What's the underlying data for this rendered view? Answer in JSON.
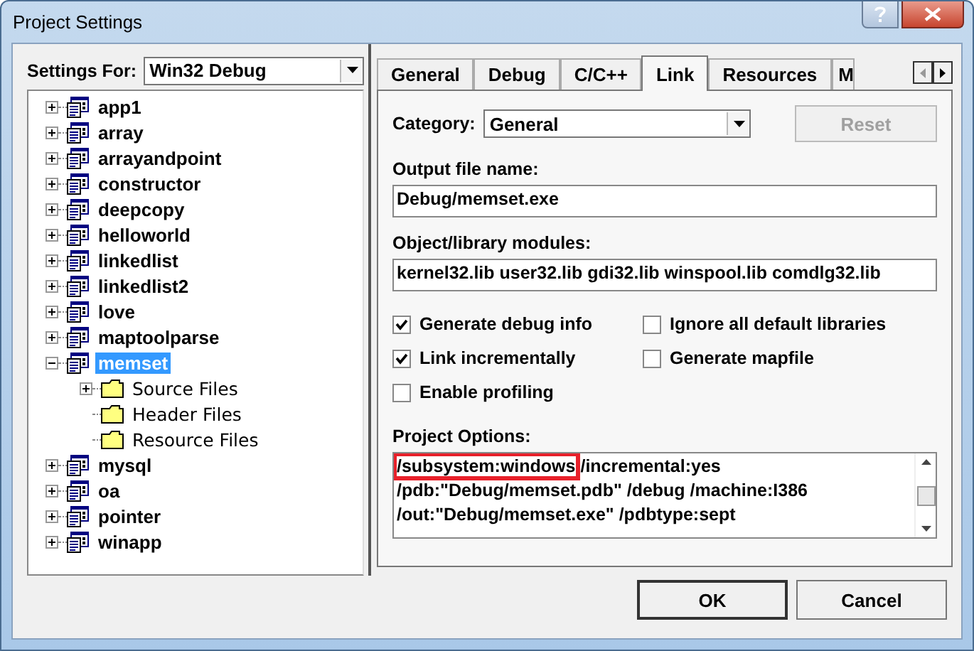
{
  "window": {
    "title": "Project Settings"
  },
  "settings_for": {
    "label": "Settings For:",
    "value": "Win32 Debug"
  },
  "tree": [
    {
      "label": "app1",
      "kind": "project",
      "expanded": false,
      "selected": false
    },
    {
      "label": "array",
      "kind": "project",
      "expanded": false,
      "selected": false
    },
    {
      "label": "arrayandpoint",
      "kind": "project",
      "expanded": false,
      "selected": false
    },
    {
      "label": "constructor",
      "kind": "project",
      "expanded": false,
      "selected": false
    },
    {
      "label": "deepcopy",
      "kind": "project",
      "expanded": false,
      "selected": false
    },
    {
      "label": "helloworld",
      "kind": "project",
      "expanded": false,
      "selected": false
    },
    {
      "label": "linkedlist",
      "kind": "project",
      "expanded": false,
      "selected": false
    },
    {
      "label": "linkedlist2",
      "kind": "project",
      "expanded": false,
      "selected": false
    },
    {
      "label": "love",
      "kind": "project",
      "expanded": false,
      "selected": false
    },
    {
      "label": "maptoolparse",
      "kind": "project",
      "expanded": false,
      "selected": false
    },
    {
      "label": "memset",
      "kind": "project",
      "expanded": true,
      "selected": true,
      "children": [
        {
          "label": "Source Files",
          "kind": "folder",
          "expanded": false,
          "selected": false
        },
        {
          "label": "Header Files",
          "kind": "folder",
          "selected": false
        },
        {
          "label": "Resource Files",
          "kind": "folder",
          "selected": false
        }
      ]
    },
    {
      "label": "mysql",
      "kind": "project",
      "expanded": false,
      "selected": false
    },
    {
      "label": "oa",
      "kind": "project",
      "expanded": false,
      "selected": false
    },
    {
      "label": "pointer",
      "kind": "project",
      "expanded": false,
      "selected": false
    },
    {
      "label": "winapp",
      "kind": "project",
      "expanded": false,
      "selected": false
    }
  ],
  "tabs": [
    {
      "label": "General",
      "selected": false
    },
    {
      "label": "Debug",
      "selected": false
    },
    {
      "label": "C/C++",
      "selected": false
    },
    {
      "label": "Link",
      "selected": true
    },
    {
      "label": "Resources",
      "selected": false
    },
    {
      "label": "M",
      "selected": false
    }
  ],
  "category": {
    "label": "Category:",
    "value": "General"
  },
  "reset_button": {
    "label": "Reset",
    "disabled": true
  },
  "output_file": {
    "label": "Output file name:",
    "value": "Debug/memset.exe"
  },
  "modules": {
    "label": "Object/library modules:",
    "value": "kernel32.lib user32.lib gdi32.lib winspool.lib comdlg32.lib"
  },
  "checkboxes": [
    {
      "label": "Generate debug info",
      "checked": true
    },
    {
      "label": "Ignore all default libraries",
      "checked": false
    },
    {
      "label": "Link incrementally",
      "checked": true
    },
    {
      "label": "Generate mapfile",
      "checked": false
    },
    {
      "label": "Enable profiling",
      "checked": false
    }
  ],
  "project_options": {
    "label": "Project Options:",
    "lines": [
      [
        {
          "text": "/subsystem:windows",
          "highlighted": true
        },
        {
          "text": "/incremental:yes",
          "highlighted": false
        }
      ],
      [
        {
          "text": "/pdb:\"Debug/memset.pdb\" /debug /machine:I386",
          "highlighted": false
        }
      ],
      [
        {
          "text": "/out:\"Debug/memset.exe\" /pdbtype:sept",
          "highlighted": false
        }
      ]
    ]
  },
  "buttons": [
    {
      "label": "OK"
    },
    {
      "label": "Cancel"
    }
  ]
}
